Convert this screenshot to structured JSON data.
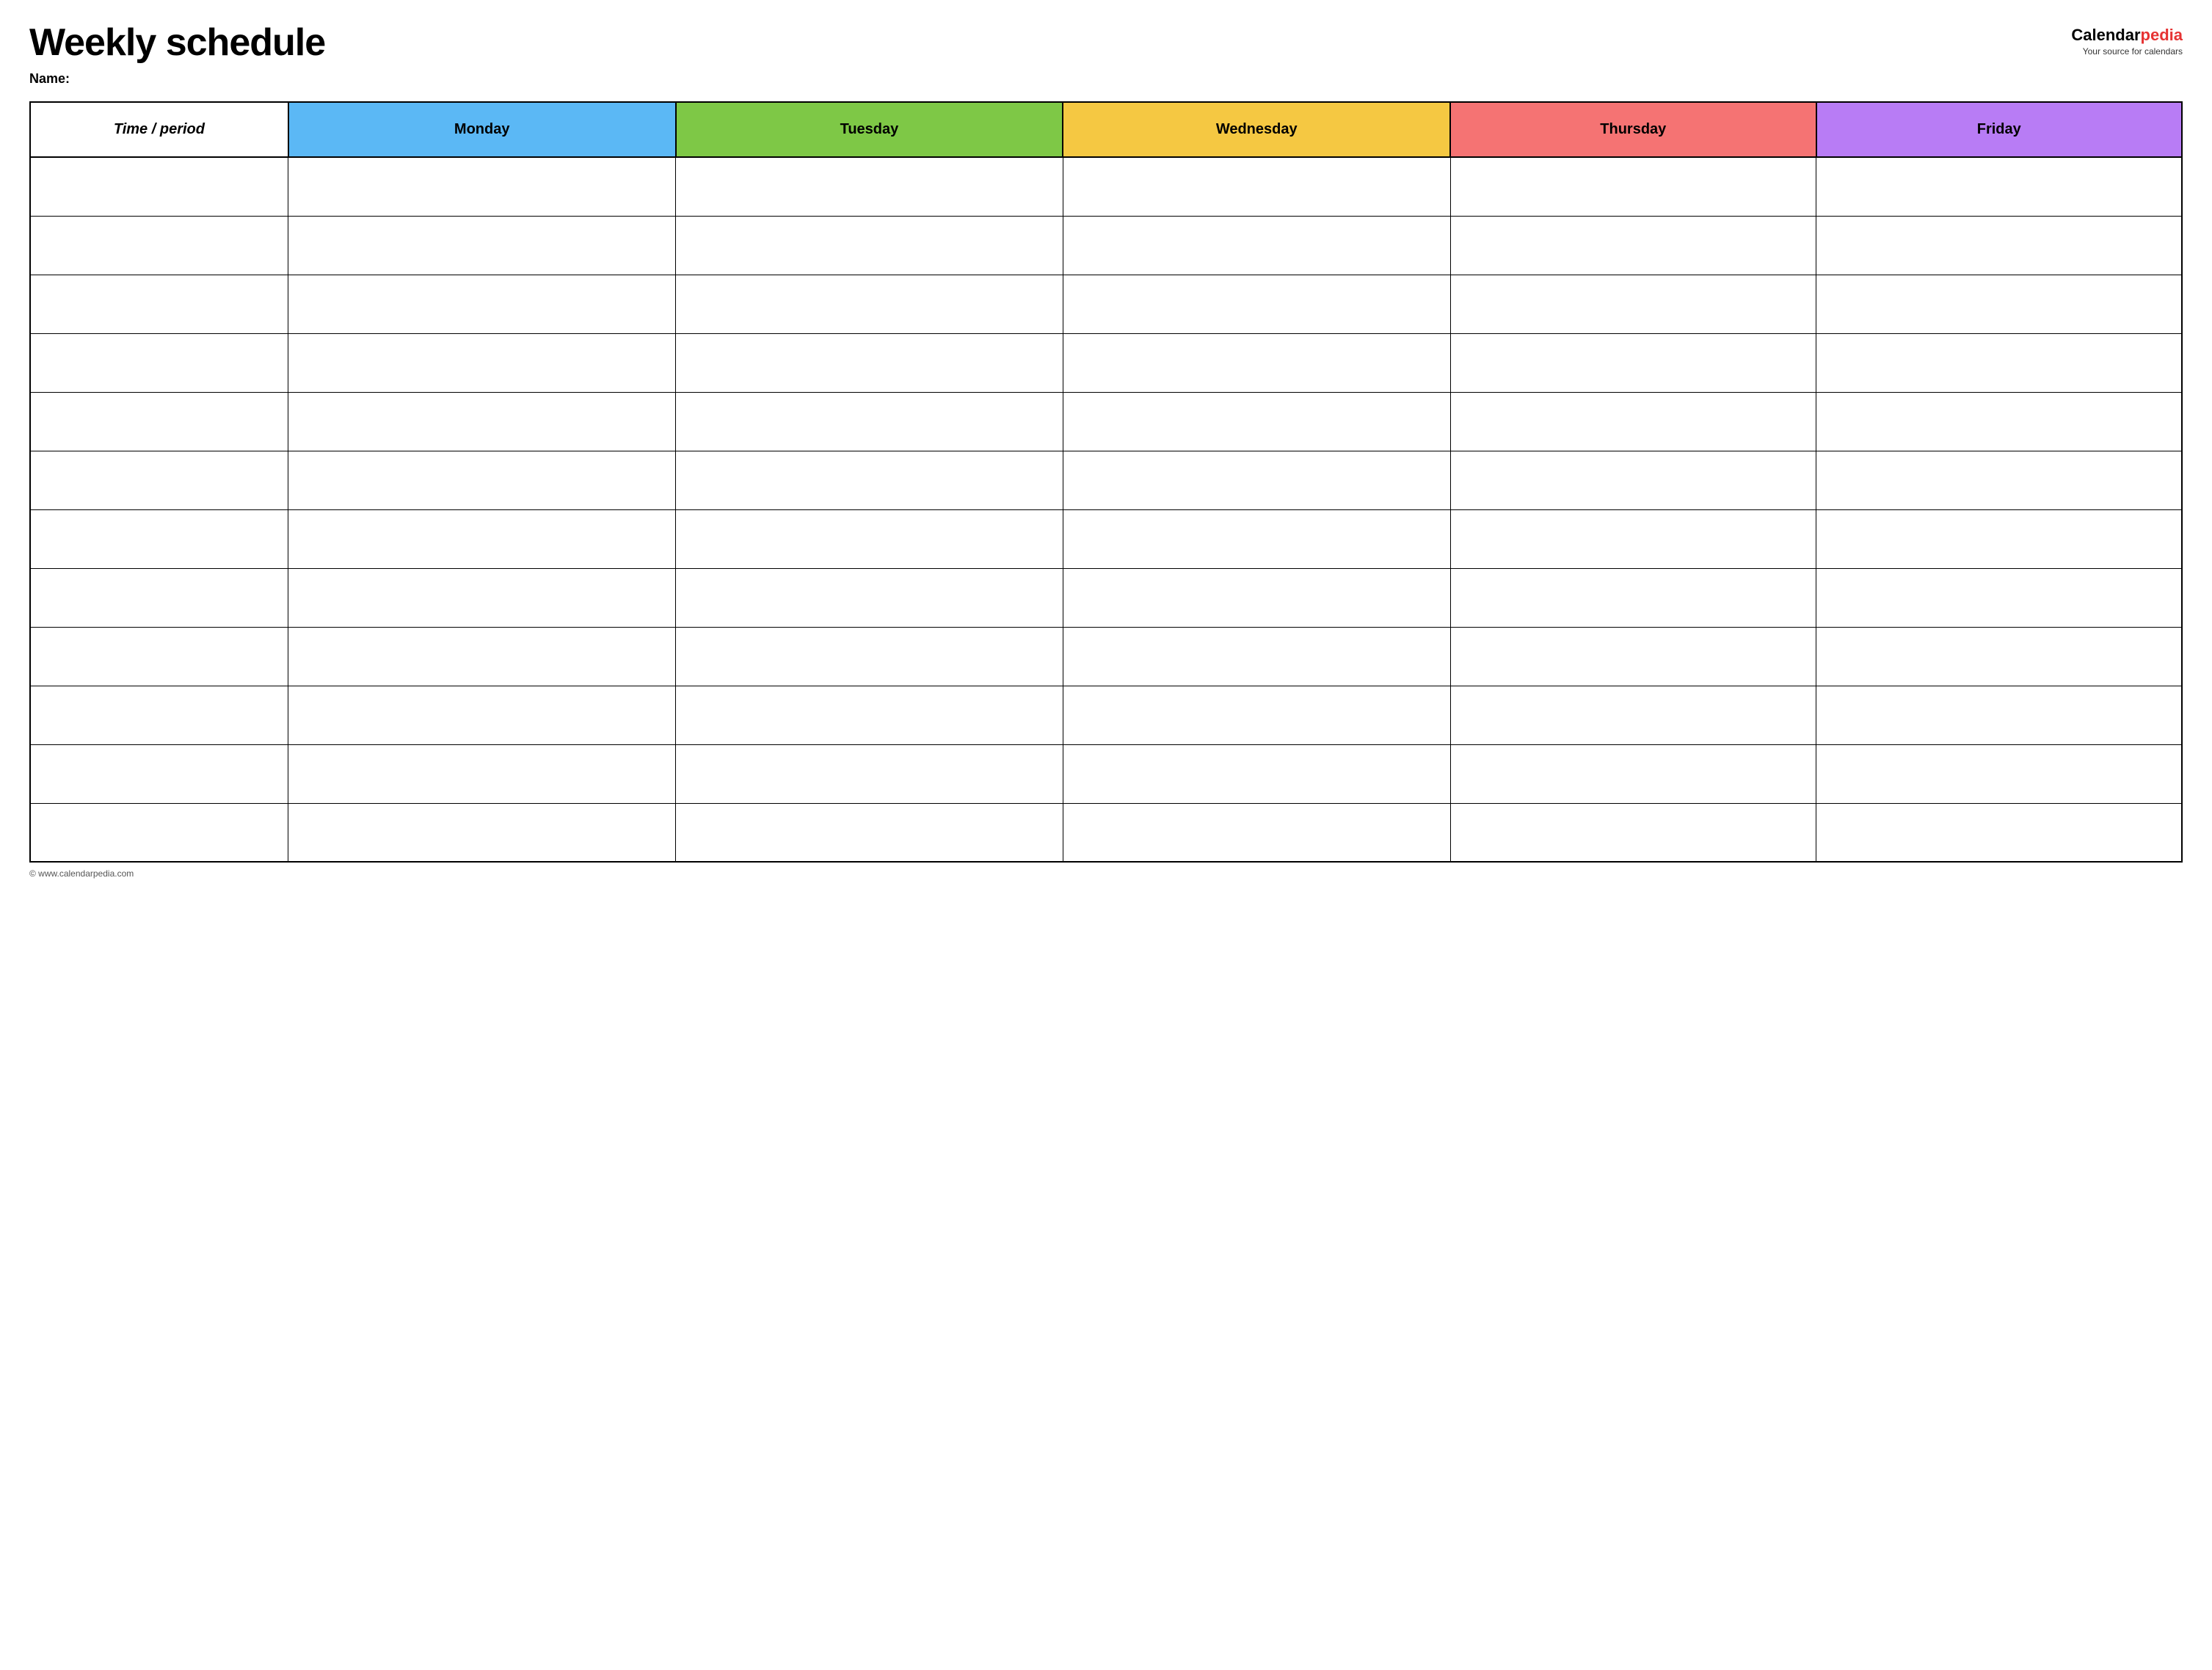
{
  "header": {
    "title": "Weekly schedule",
    "name_label": "Name:",
    "logo": {
      "calendar_text": "Calendar",
      "pedia_text": "pedia",
      "tagline": "Your source for calendars"
    }
  },
  "table": {
    "headers": [
      {
        "id": "time",
        "label": "Time / period",
        "color": "#ffffff"
      },
      {
        "id": "monday",
        "label": "Monday",
        "color": "#5bb8f5"
      },
      {
        "id": "tuesday",
        "label": "Tuesday",
        "color": "#7ec846"
      },
      {
        "id": "wednesday",
        "label": "Wednesday",
        "color": "#f5c842"
      },
      {
        "id": "thursday",
        "label": "Thursday",
        "color": "#f57373"
      },
      {
        "id": "friday",
        "label": "Friday",
        "color": "#b87cf5"
      }
    ],
    "row_count": 12
  },
  "footer": {
    "copyright": "© www.calendarpedia.com"
  }
}
